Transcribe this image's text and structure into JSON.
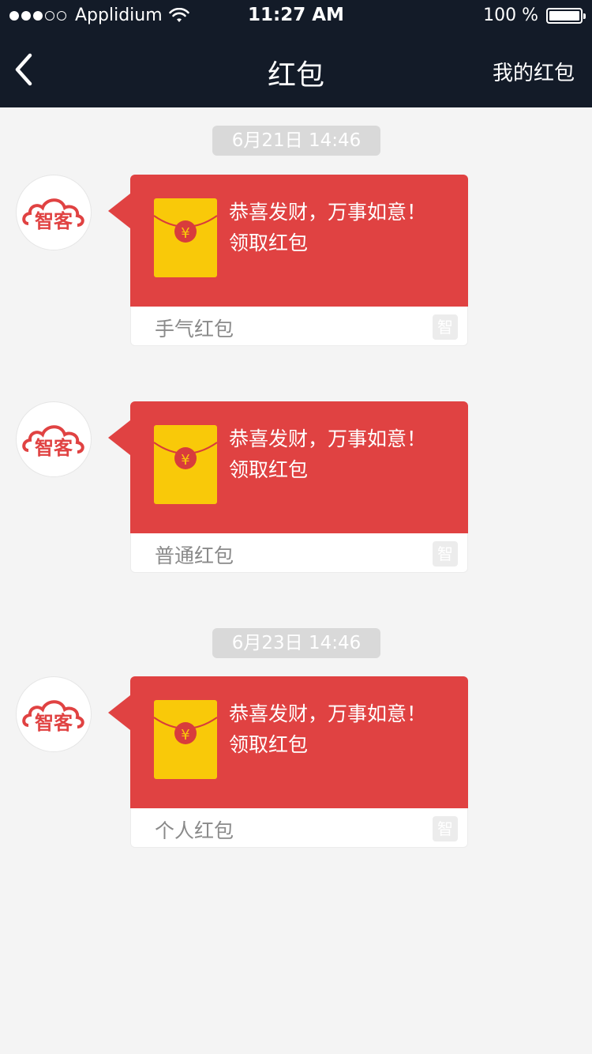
{
  "status_bar": {
    "carrier": "Applidium",
    "time": "11:27 AM",
    "battery": "100 %"
  },
  "nav": {
    "title": "红包",
    "right_label": "我的红包",
    "back_icon": "chevron-left-icon"
  },
  "avatar_text": "智客",
  "timestamps": [
    "6月21日  14:46",
    "6月23日  14:46"
  ],
  "messages": [
    {
      "line1": "恭喜发财，万事如意！",
      "line2": "领取红包",
      "type": "手气红包",
      "badge": "智"
    },
    {
      "line1": "恭喜发财，万事如意！",
      "line2": "领取红包",
      "type": "普通红包",
      "badge": "智"
    },
    {
      "line1": "恭喜发财，万事如意！",
      "line2": "领取红包",
      "type": "个人红包",
      "badge": "智"
    }
  ],
  "colors": {
    "nav_bg": "#131b28",
    "packet_red": "#e04242",
    "envelope_yellow": "#f9c909",
    "page_bg": "#f4f4f4"
  }
}
